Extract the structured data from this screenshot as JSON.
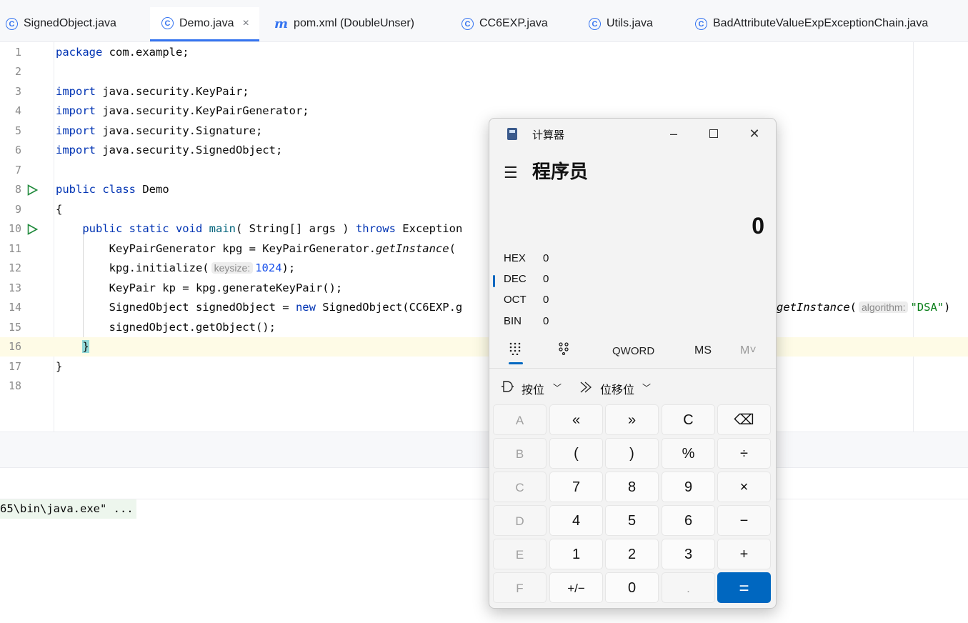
{
  "tabs": [
    {
      "label": "SignedObject.java",
      "icon": "class-icon"
    },
    {
      "label": "Demo.java",
      "icon": "class-icon",
      "active": true
    },
    {
      "label": "pom.xml (DoubleUnser)",
      "icon": "maven-icon"
    },
    {
      "label": "CC6EXP.java",
      "icon": "class-icon"
    },
    {
      "label": "Utils.java",
      "icon": "class-icon"
    },
    {
      "label": "BadAttributeValueExpExceptionChain.java",
      "icon": "class-icon"
    }
  ],
  "editor": {
    "line_numbers": [
      "1",
      "2",
      "3",
      "4",
      "5",
      "6",
      "7",
      "8",
      "9",
      "10",
      "11",
      "12",
      "13",
      "14",
      "15",
      "16",
      "17",
      "18"
    ],
    "l1_kw": "package",
    "l1_rest": " com.example;",
    "l3_kw": "import",
    "l3_rest": " java.security.KeyPair;",
    "l4_kw": "import",
    "l4_rest": " java.security.KeyPairGenerator;",
    "l5_kw": "import",
    "l5_rest": " java.security.Signature;",
    "l6_kw": "import",
    "l6_rest": " java.security.SignedObject;",
    "l8_kw1": "public",
    "l8_kw2": "class",
    "l8_rest": " Demo",
    "l9": "{",
    "l10_kw": "public static void",
    "l10_m": "main",
    "l10_a": "( String[] args ) ",
    "l10_kw2": "throws",
    "l10_b": " Exception",
    "l11_a": "KeyPairGenerator kpg = KeyPairGenerator.",
    "l11_it": "getInstance",
    "l11_b": "(",
    "l12_a": "kpg.initialize(",
    "l12_hint": "keysize:",
    "l12_num": "1024",
    "l12_b": ");",
    "l13": "KeyPair kp = kpg.generateKeyPair();",
    "l14_a": "SignedObject signedObject = ",
    "l14_kw": "new",
    "l14_b": " SignedObject(CC6EXP.g",
    "l14_it": "getInstance",
    "l14_c": "(",
    "l14_hint": "algorithm:",
    "l14_str": "\"DSA\"",
    "l14_d": ")",
    "l15": "signedObject.getObject();",
    "l16": "}",
    "l17": "}"
  },
  "console": {
    "text": "65\\bin\\java.exe\" ..."
  },
  "calculator": {
    "title": "计算器",
    "mode": "程序员",
    "display": "0",
    "bases": [
      {
        "name": "HEX",
        "value": "0"
      },
      {
        "name": "DEC",
        "value": "0",
        "selected": true
      },
      {
        "name": "OCT",
        "value": "0"
      },
      {
        "name": "BIN",
        "value": "0"
      }
    ],
    "word_size": "QWORD",
    "ms": "MS",
    "mv": "M˅",
    "bitwise": "按位",
    "bitshift": "位移位",
    "keys": [
      [
        "A",
        "«",
        "»",
        "C",
        "⌫"
      ],
      [
        "B",
        "(",
        ")",
        "%",
        "÷"
      ],
      [
        "C",
        "7",
        "8",
        "9",
        "×"
      ],
      [
        "D",
        "4",
        "5",
        "6",
        "−"
      ],
      [
        "E",
        "1",
        "2",
        "3",
        "+"
      ],
      [
        "F",
        "+/−",
        "0",
        ".",
        "="
      ]
    ]
  }
}
